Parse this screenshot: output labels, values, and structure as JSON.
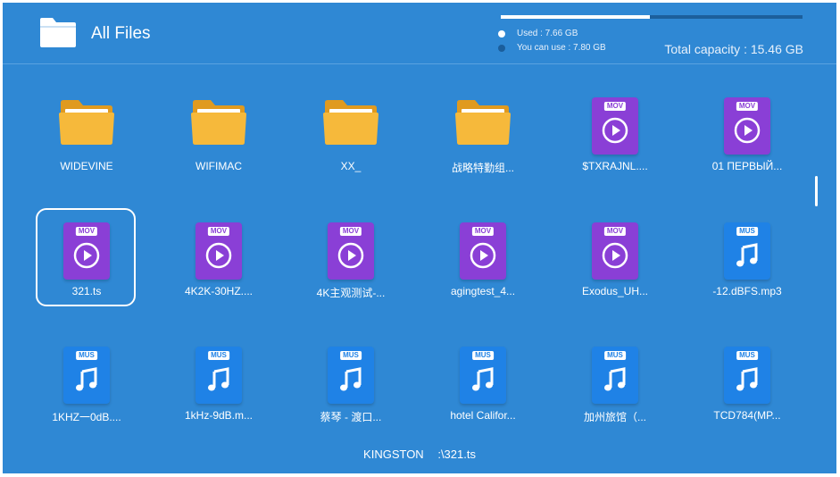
{
  "header": {
    "title": "All Files",
    "used_label": "Used : 7.66 GB",
    "available_label": "You can use : 7.80 GB",
    "total_label": "Total capacity : 15.46 GB",
    "used_fraction": 0.495
  },
  "files": [
    {
      "name": "WIDEVINE",
      "type": "folder"
    },
    {
      "name": "WIFIMAC",
      "type": "folder"
    },
    {
      "name": "XX_",
      "type": "folder"
    },
    {
      "name": "战略特勤组...",
      "type": "folder"
    },
    {
      "name": "$TXRAJNL....",
      "type": "mov"
    },
    {
      "name": "01 ПЕРВЫЙ...",
      "type": "mov"
    },
    {
      "name": "321.ts",
      "type": "mov",
      "selected": true
    },
    {
      "name": "4K2K-30HZ....",
      "type": "mov"
    },
    {
      "name": "4K主观测试-...",
      "type": "mov"
    },
    {
      "name": "agingtest_4...",
      "type": "mov"
    },
    {
      "name": "Exodus_UH...",
      "type": "mov"
    },
    {
      "name": "-12.dBFS.mp3",
      "type": "mus"
    },
    {
      "name": "1KHZ一0dB....",
      "type": "mus"
    },
    {
      "name": "1kHz-9dB.m...",
      "type": "mus"
    },
    {
      "name": "蔡琴 - 渡口...",
      "type": "mus"
    },
    {
      "name": "hotel Califor...",
      "type": "mus"
    },
    {
      "name": "加州旅馆（...",
      "type": "mus"
    },
    {
      "name": "TCD784(MP...",
      "type": "mus"
    }
  ],
  "file_tags": {
    "mov": "MOV",
    "mus": "MUS"
  },
  "footer": {
    "device": "KINGSTON",
    "path": ":\\321.ts"
  },
  "colors": {
    "background": "#2f88d4",
    "folder": "#f6b93b",
    "mov_icon": "#8a3fd6",
    "mus_icon": "#1f82e6"
  }
}
